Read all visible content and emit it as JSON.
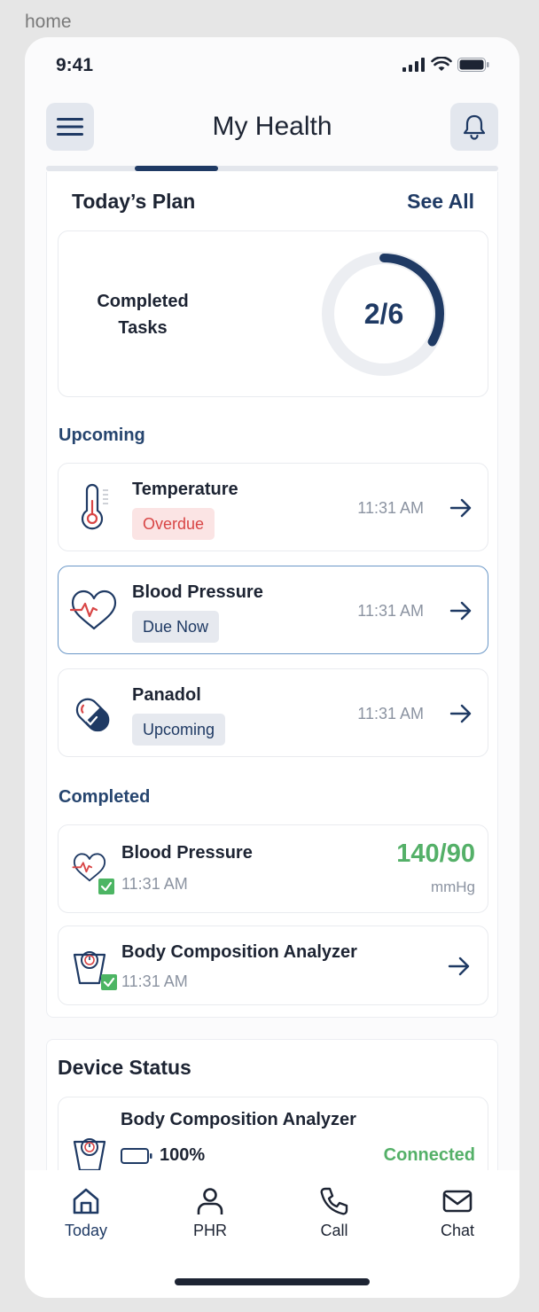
{
  "frame_label": "home",
  "status_bar": {
    "time": "9:41"
  },
  "header": {
    "title": "My Health"
  },
  "plan": {
    "heading": "Today’s Plan",
    "see_all": "See All",
    "progress": {
      "label_line1": "Completed",
      "label_line2": "Tasks",
      "display": "2/6",
      "completed": 2,
      "total": 6
    }
  },
  "upcoming": {
    "heading": "Upcoming",
    "items": [
      {
        "name": "Temperature",
        "badge": "Overdue",
        "time": "11:31 AM",
        "icon": "thermometer-icon"
      },
      {
        "name": "Blood Pressure",
        "badge": "Due Now",
        "time": "11:31 AM",
        "icon": "heart-pulse-icon"
      },
      {
        "name": "Panadol",
        "badge": "Upcoming",
        "time": "11:31 AM",
        "icon": "pill-icon"
      }
    ]
  },
  "completed": {
    "heading": "Completed",
    "items": [
      {
        "name": "Blood Pressure",
        "time": "11:31 AM",
        "value": "140/90",
        "unit": "mmHg",
        "icon": "heart-pulse-icon"
      },
      {
        "name": "Body Composition Analyzer",
        "time": "11:31 AM",
        "icon": "scale-icon"
      }
    ]
  },
  "device_status": {
    "heading": "Device Status",
    "device": {
      "name": "Body Composition Analyzer",
      "battery": "100%",
      "status": "Connected",
      "icon": "scale-icon"
    }
  },
  "tabs": [
    {
      "label": "Today",
      "icon": "home-icon"
    },
    {
      "label": "PHR",
      "icon": "person-icon"
    },
    {
      "label": "Call",
      "icon": "phone-icon"
    },
    {
      "label": "Chat",
      "icon": "mail-icon"
    }
  ],
  "colors": {
    "primary": "#1f3a64",
    "success": "#54b068",
    "danger": "#d84545",
    "background": "#e6e6e6"
  }
}
